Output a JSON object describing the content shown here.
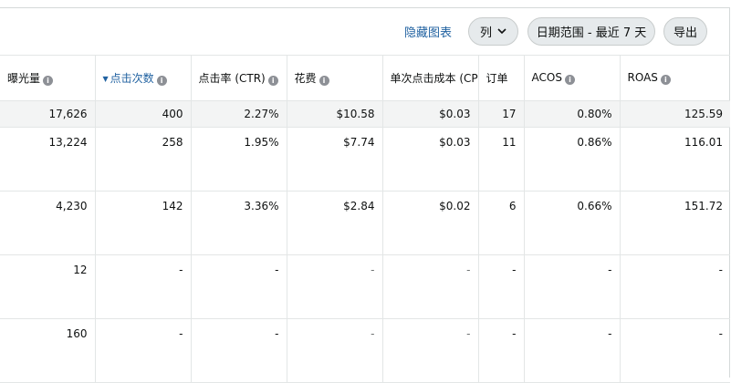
{
  "toolbar": {
    "hide_chart": "隐藏图表",
    "columns_label": "列",
    "date_range_label": "日期范围 - 最近 7 天",
    "export_label": "导出"
  },
  "columns": [
    {
      "label": "曝光量",
      "info": true,
      "sorted": false
    },
    {
      "label": "点击次数",
      "info": true,
      "sorted": true
    },
    {
      "label": "点击率 (CTR)",
      "info": true,
      "sorted": false
    },
    {
      "label": "花费",
      "info": true,
      "sorted": false
    },
    {
      "label": "单次点击成本 (CPC)",
      "info": false,
      "sorted": false
    },
    {
      "label": "订单",
      "info": false,
      "sorted": false
    },
    {
      "label": "ACOS",
      "info": true,
      "sorted": false
    },
    {
      "label": "ROAS",
      "info": true,
      "sorted": false
    }
  ],
  "total_row": [
    "17,626",
    "400",
    "2.27%",
    "$10.58",
    "$0.03",
    "17",
    "0.80%",
    "125.59"
  ],
  "rows": [
    [
      "13,224",
      "258",
      "1.95%",
      "$7.74",
      "$0.03",
      "11",
      "0.86%",
      "116.01"
    ],
    [
      "4,230",
      "142",
      "3.36%",
      "$2.84",
      "$0.02",
      "6",
      "0.66%",
      "151.72"
    ],
    [
      "12",
      "-",
      "-",
      "-",
      "-",
      "-",
      "-",
      "-"
    ],
    [
      "160",
      "-",
      "-",
      "-",
      "-",
      "-",
      "-",
      "-"
    ]
  ],
  "muted_columns": [
    3,
    4
  ]
}
